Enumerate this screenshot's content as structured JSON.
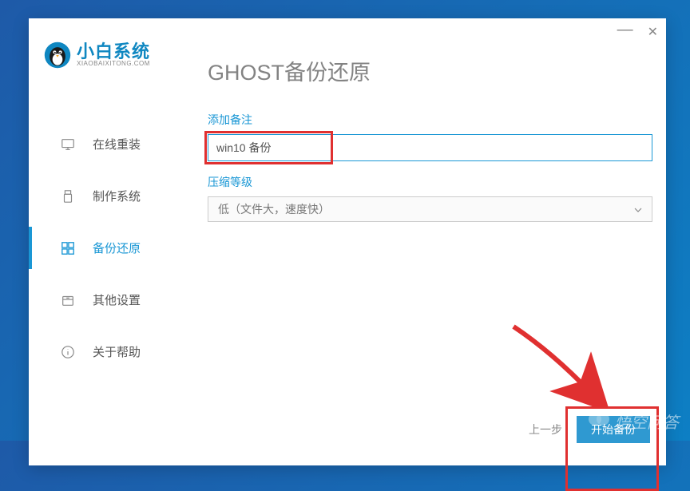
{
  "logo": {
    "main": "小白系统",
    "sub": "XIAOBAIXITONG.COM"
  },
  "page_title": "GHOST备份还原",
  "sidebar": {
    "items": [
      {
        "label": "在线重装"
      },
      {
        "label": "制作系统"
      },
      {
        "label": "备份还原"
      },
      {
        "label": "其他设置"
      },
      {
        "label": "关于帮助"
      }
    ]
  },
  "form": {
    "note_label": "添加备注",
    "note_value": "win10 备份",
    "compress_label": "压缩等级",
    "compress_value": "低（文件大，速度快）"
  },
  "buttons": {
    "prev": "上一步",
    "start": "开始备份"
  },
  "watermark": "悟空问答"
}
